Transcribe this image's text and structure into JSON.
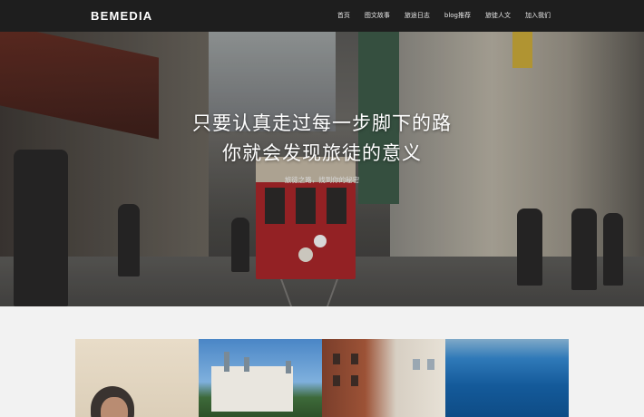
{
  "header": {
    "logo": "BEMEDIA",
    "nav": [
      "首页",
      "图文故事",
      "旅途日志",
      "blog推荐",
      "旅徒人文",
      "加入我们"
    ]
  },
  "hero": {
    "line1": "只要认真走过每一步脚下的路",
    "line2": "你就会发现旅徒的意义",
    "subtitle": "旅徒之路，找到你的秘密"
  },
  "gallery": {
    "tiles": [
      "portrait-photo",
      "castle-photo",
      "building-photo",
      "ocean-photo"
    ]
  },
  "colors": {
    "topbar": "#1e1e1e",
    "page_bg": "#f2f2f2",
    "tram_red": "#a8262a"
  }
}
